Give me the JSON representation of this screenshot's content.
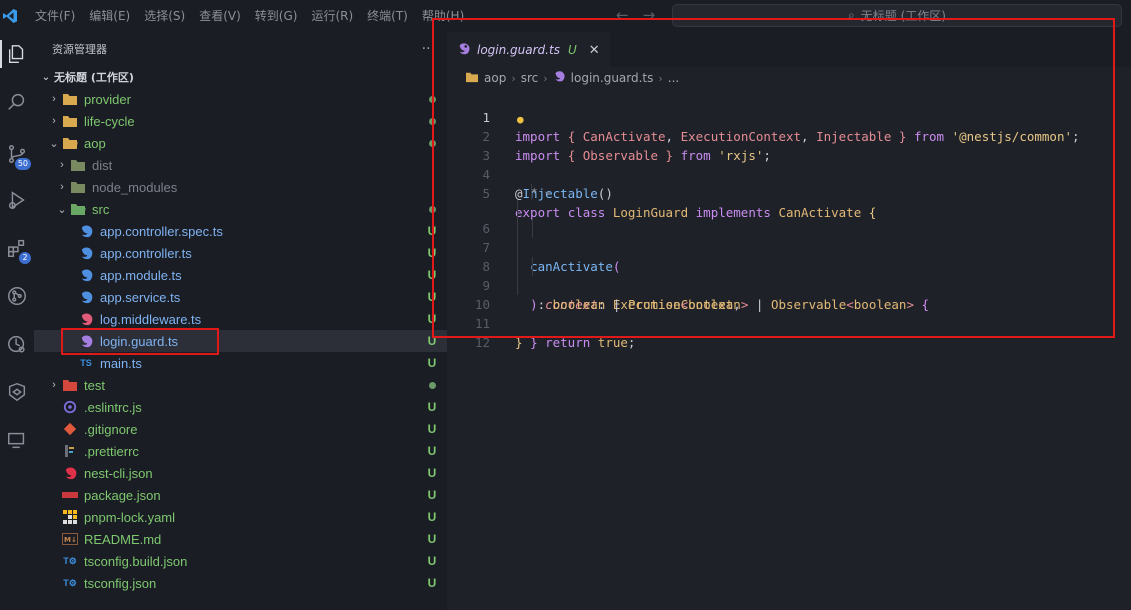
{
  "titlebar": {
    "menus": [
      "文件(F)",
      "编辑(E)",
      "选择(S)",
      "查看(V)",
      "转到(G)",
      "运行(R)",
      "终端(T)",
      "帮助(H)"
    ],
    "command_center": "无标题 (工作区)"
  },
  "activity": {
    "scm_badge": "50",
    "extensions_badge": "2"
  },
  "sidebar": {
    "title": "资源管理器",
    "more": "···",
    "workspace": "无标题 (工作区)",
    "items": [
      {
        "label": "provider",
        "status": "dot",
        "kind": "folder",
        "color": "#7ec86f"
      },
      {
        "label": "life-cycle",
        "status": "dot",
        "kind": "folder",
        "color": "#7ec86f"
      },
      {
        "label": "aop",
        "status": "dot",
        "kind": "folder-open",
        "color": "#7ec86f"
      },
      {
        "label": "dist",
        "status": "",
        "kind": "folder",
        "color": "#7c808a"
      },
      {
        "label": "node_modules",
        "status": "",
        "kind": "folder",
        "color": "#7c808a"
      },
      {
        "label": "src",
        "status": "dot",
        "kind": "folder-open",
        "color": "#7ec86f"
      },
      {
        "label": "app.controller.spec.ts",
        "status": "U",
        "kind": "file",
        "color": "#7fb3f2"
      },
      {
        "label": "app.controller.ts",
        "status": "U",
        "kind": "file",
        "color": "#7fb3f2"
      },
      {
        "label": "app.module.ts",
        "status": "U",
        "kind": "file",
        "color": "#7fb3f2"
      },
      {
        "label": "app.service.ts",
        "status": "U",
        "kind": "file",
        "color": "#7fb3f2"
      },
      {
        "label": "log.middleware.ts",
        "status": "U",
        "kind": "file",
        "color": "#7fb3f2"
      },
      {
        "label": "login.guard.ts",
        "status": "U",
        "kind": "file",
        "color": "#7fb3f2"
      },
      {
        "label": "main.ts",
        "status": "U",
        "kind": "file",
        "color": "#7fb3f2"
      },
      {
        "label": "test",
        "status": "dot",
        "kind": "folder",
        "color": "#7ec86f"
      },
      {
        "label": ".eslintrc.js",
        "status": "U",
        "kind": "file",
        "color": "#7ec86f"
      },
      {
        "label": ".gitignore",
        "status": "U",
        "kind": "file",
        "color": "#7ec86f"
      },
      {
        "label": ".prettierrc",
        "status": "U",
        "kind": "file",
        "color": "#7ec86f"
      },
      {
        "label": "nest-cli.json",
        "status": "U",
        "kind": "file",
        "color": "#7ec86f"
      },
      {
        "label": "package.json",
        "status": "U",
        "kind": "file",
        "color": "#7ec86f"
      },
      {
        "label": "pnpm-lock.yaml",
        "status": "U",
        "kind": "file",
        "color": "#7ec86f"
      },
      {
        "label": "README.md",
        "status": "U",
        "kind": "file",
        "color": "#7ec86f"
      },
      {
        "label": "tsconfig.build.json",
        "status": "U",
        "kind": "file",
        "color": "#7ec86f"
      },
      {
        "label": "tsconfig.json",
        "status": "U",
        "kind": "file",
        "color": "#7ec86f"
      }
    ]
  },
  "editor": {
    "tab": {
      "label": "login.guard.ts",
      "status": "U",
      "close": "✕"
    },
    "breadcrumb": [
      "aop",
      "src",
      "login.guard.ts",
      "..."
    ],
    "line_numbers": [
      "1",
      "2",
      "3",
      "4",
      "5",
      "6",
      "7",
      "8",
      "9",
      "10",
      "11",
      "12"
    ],
    "lines": [
      "import { CanActivate, ExecutionContext, Injectable } from '@nestjs/common';",
      "import { Observable } from 'rxjs';",
      "",
      "@Injectable()",
      "export class LoginGuard implements CanActivate {",
      "  canActivate(",
      "    context: ExecutionContext,",
      "  ): boolean | Promise<boolean> | Observable<boolean> {",
      "    return true;",
      "  }",
      "}",
      ""
    ]
  },
  "colors": {
    "accent": "#3d6fd1",
    "untracked": "#7ec86f",
    "highlight_box": "#e11919"
  }
}
